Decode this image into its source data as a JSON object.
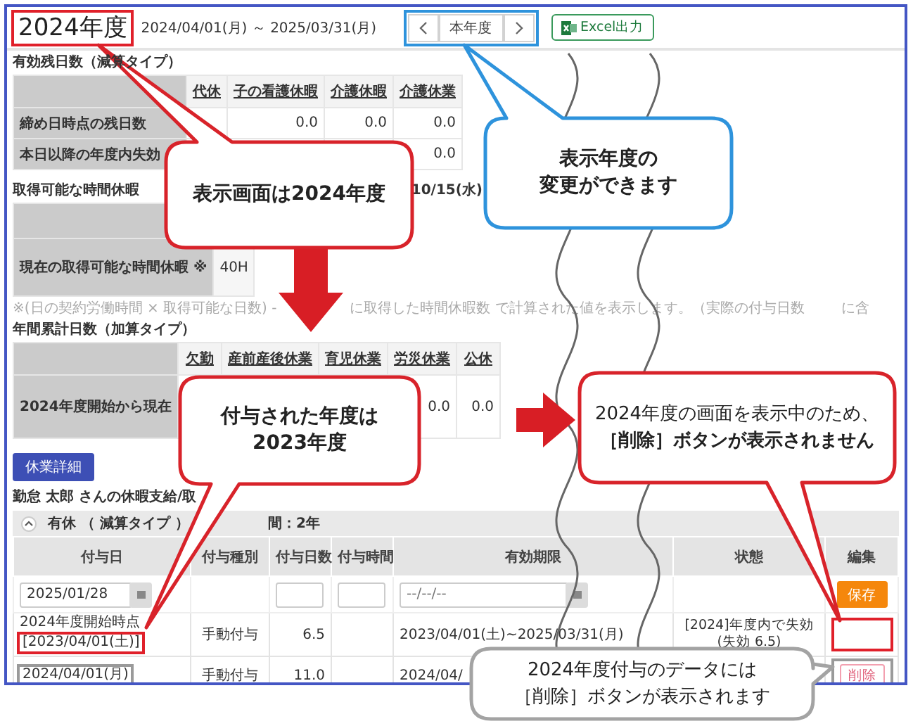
{
  "header": {
    "title": "2024年度",
    "highlight": {
      "color": "#e0202a"
    },
    "period": "2024/04/01(月) ～ 2025/03/31(月)",
    "year_nav": {
      "label": "本年度",
      "highlight": {
        "color": "#2e93dc"
      }
    },
    "export_button": "Excel出力"
  },
  "remaining": {
    "title": "有効残日数（減算タイプ）",
    "columns": [
      "代休",
      "子の看護休暇",
      "介護休暇",
      "介護休業"
    ],
    "rows": [
      {
        "label": "締め日時点の残日数",
        "values": [
          "0.0",
          "0.0",
          "0.0"
        ]
      },
      {
        "label": "本日以降の年度内失効",
        "values": [
          "0.0"
        ]
      }
    ]
  },
  "hourly": {
    "title": "取得可能な時間休暇",
    "date": "10/15(水)",
    "rows": [
      {
        "label": "現在の取得可能な時間休暇 ※",
        "value": "40H"
      }
    ],
    "note": [
      "※(日の契約労働時間 × 取得可能な日数) -",
      "に取得した時間休暇数 で計算された値を表示します。（実際の付与日数",
      "に含"
    ]
  },
  "annual": {
    "title": "年間累計日数（加算タイプ）",
    "columns": [
      "欠勤",
      "産前産後休業",
      "育児休業",
      "労災休業",
      "公休"
    ],
    "rows": [
      {
        "label": "2024年度開始から現在",
        "values": [
          "0.0",
          "0.0"
        ]
      }
    ]
  },
  "detail_button": "休業詳細",
  "owner_text": "勤怠 太郎 さんの休暇支給/取",
  "grant_panel": {
    "expanded": true,
    "title": "有休 （ 減算タイプ ）",
    "period": "間：2年",
    "columns": [
      "付与日",
      "付与種別",
      "付与日数",
      "付与時間",
      "有効期限",
      "状態",
      "編集"
    ],
    "input_row": {
      "date": "2025/01/28",
      "expiry_placeholder": "--/--/--",
      "save_button": "保存"
    },
    "rows": [
      {
        "date_note": "2024年度開始時点",
        "date": "[2023/04/01(土)]",
        "date_highlight": {
          "color": "#e0202a"
        },
        "type": "手動付与",
        "days": "6.5",
        "validity": "2023/04/01(土)~2025/03/31(月)",
        "status": [
          "[2024]年度内で失効",
          "(失効 6.5)"
        ],
        "edit_highlight": {
          "color": "#e0202a"
        }
      },
      {
        "date": "2024/04/01(月)",
        "date_highlight": {
          "color": "#9a9a9a"
        },
        "type": "手動付与",
        "days": "11.0",
        "validity": "2024/04/",
        "delete_button": "削除",
        "edit_highlight": {
          "color": "#9a9a9a"
        }
      }
    ]
  },
  "callouts": [
    {
      "kind": "alert",
      "lines": [
        {
          "text": "表示画面は2024年度",
          "bold": true
        }
      ]
    },
    {
      "kind": "info",
      "lines": [
        {
          "text": "表示年度の",
          "bold": true
        },
        {
          "text": "変更ができます",
          "bold": true
        }
      ]
    },
    {
      "kind": "alert",
      "lines": [
        {
          "text": "付与された年度は",
          "bold": true
        },
        {
          "text": "2023年度",
          "bold": true
        }
      ]
    },
    {
      "kind": "alert",
      "lines": [
        {
          "text": "2024年度の画面を表示中のため、",
          "bold": false
        },
        {
          "text": "［削除］ボタンが表示されません",
          "bold": true
        }
      ]
    },
    {
      "kind": "note",
      "lines": [
        {
          "text": "2024年度付与のデータには",
          "bold": false
        },
        {
          "text": "［削除］ボタンが表示されます",
          "bold": false
        }
      ]
    }
  ]
}
